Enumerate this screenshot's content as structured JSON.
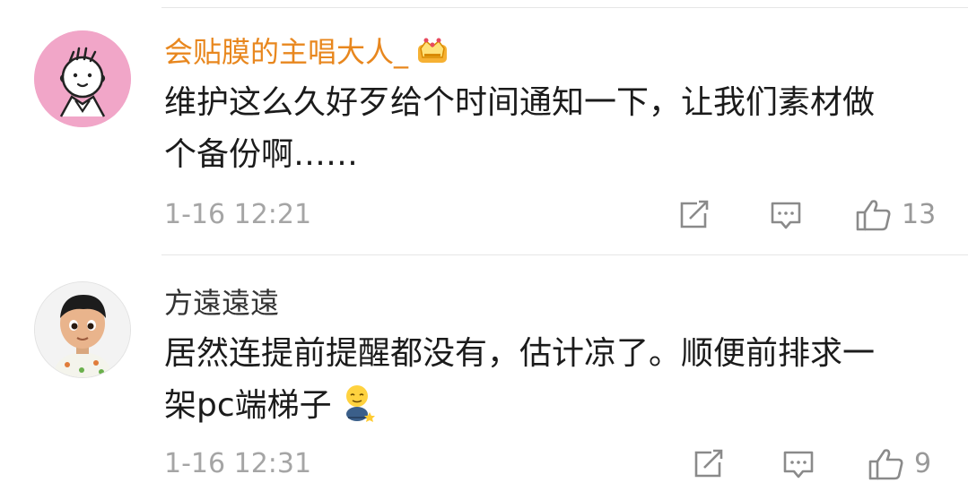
{
  "comments": [
    {
      "username": "会贴膜的主唱大人_",
      "text_lines": [
        "维护这么久好歹给个时间通知一下，让我们素材做",
        "个备份啊……"
      ],
      "time": "1-16 12:21",
      "likes": "13",
      "badge_icon": "crown-icon",
      "colors": {
        "username": "#e8871e"
      }
    },
    {
      "username": "方遠遠遠",
      "text_lines": [
        "居然连提前提醒都没有，估计凉了。顺便前排求一",
        "架pc端梯子"
      ],
      "time": "1-16 12:31",
      "likes": "9",
      "emoji_icon": "emoji-icon"
    }
  ],
  "icons": {
    "repost": "repost-icon",
    "reply": "comment-icon",
    "like": "thumbs-up-icon"
  },
  "colors": {
    "meta_text": "#a5a5a5",
    "avatar_1_bg": "#f1a6c8"
  }
}
